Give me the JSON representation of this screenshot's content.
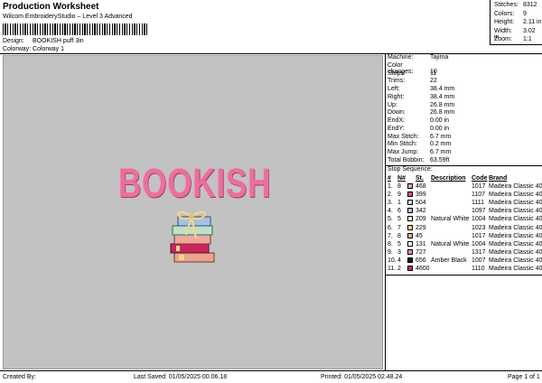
{
  "header": {
    "title": "Production Worksheet",
    "subtitle": "Wilcom EmbroideryStudio – Level 3 Advanced",
    "design_label": "Design:",
    "design_value": "BOOKISH puff 3in",
    "colorway_label": "Colorway:",
    "colorway_value": "Colorway 1"
  },
  "stats": [
    {
      "label": "Stitches:",
      "value": "8312"
    },
    {
      "label": "Colors:",
      "value": "9"
    },
    {
      "label": "Height:",
      "value": "2.11 in"
    },
    {
      "label": "Width:",
      "value": "3.02 in"
    },
    {
      "label": "Zoom:",
      "value": "1:1"
    }
  ],
  "design": {
    "word": "BOOKISH",
    "word_color": "#e8709f"
  },
  "machine_info": [
    {
      "label": "Machine:",
      "value": "Tajima"
    },
    {
      "label": "Color changes:",
      "value": "10"
    },
    {
      "label": "Stops:",
      "value": "11"
    },
    {
      "label": "Trims:",
      "value": "22"
    },
    {
      "label": "Left:",
      "value": "38.4 mm"
    },
    {
      "label": "Right:",
      "value": "38.4 mm"
    },
    {
      "label": "Up:",
      "value": "26.8 mm"
    },
    {
      "label": "Down:",
      "value": "26.8 mm"
    },
    {
      "label": "EndX:",
      "value": "0.00 in"
    },
    {
      "label": "EndY:",
      "value": "0.00 in"
    },
    {
      "label": "Max Stitch:",
      "value": "6.7 mm"
    },
    {
      "label": "Min Stitch:",
      "value": "0.2 mm"
    },
    {
      "label": "Max Jump:",
      "value": "6.7 mm"
    },
    {
      "label": "Total Bobbin:",
      "value": "63.59ft"
    }
  ],
  "stop_sequence": {
    "title": "Stop Sequence:",
    "headers": {
      "num": "#",
      "n": "N#",
      "st": "St.",
      "description": "Description",
      "code": "Code",
      "brand": "Brand"
    },
    "rows": [
      {
        "num": "1.",
        "n": "8",
        "st": "468",
        "color": "#f0a6a0",
        "description": "",
        "code": "1017",
        "brand": "Madeira Classic 40"
      },
      {
        "num": "2.",
        "n": "9",
        "st": "399",
        "color": "#e0506e",
        "description": "",
        "code": "1107",
        "brand": "Madeira Classic 40"
      },
      {
        "num": "3.",
        "n": "1",
        "st": "504",
        "color": "#bfe0c8",
        "description": "",
        "code": "1111",
        "brand": "Madeira Classic 40"
      },
      {
        "num": "4.",
        "n": "6",
        "st": "342",
        "color": "#a9c0e6",
        "description": "",
        "code": "1097",
        "brand": "Madeira Classic 40"
      },
      {
        "num": "5.",
        "n": "5",
        "st": "209",
        "color": "#ffffff",
        "description": "Natural White",
        "code": "1004",
        "brand": "Madeira Classic 40"
      },
      {
        "num": "6.",
        "n": "7",
        "st": "229",
        "color": "#f6d784",
        "description": "",
        "code": "1023",
        "brand": "Madeira Classic 40"
      },
      {
        "num": "7.",
        "n": "8",
        "st": "45",
        "color": "#f0a6a0",
        "description": "",
        "code": "1017",
        "brand": "Madeira Classic 40"
      },
      {
        "num": "8.",
        "n": "5",
        "st": "131",
        "color": "#ffffff",
        "description": "Natural White",
        "code": "1004",
        "brand": "Madeira Classic 40"
      },
      {
        "num": "9.",
        "n": "3",
        "st": "727",
        "color": "#f08a9c",
        "description": "",
        "code": "1317",
        "brand": "Madeira Classic 40"
      },
      {
        "num": "10.",
        "n": "4",
        "st": "656",
        "color": "#1a1a1a",
        "description": "Amber Black",
        "code": "1007",
        "brand": "Madeira Classic 40"
      },
      {
        "num": "11.",
        "n": "2",
        "st": "4600",
        "color": "#c8265e",
        "description": "",
        "code": "1110",
        "brand": "Madeira Classic 40"
      }
    ]
  },
  "footer": {
    "created_by": "Created By:",
    "last_saved": "Last Saved: 01/05/2025 00.06.18",
    "printed": "Printed: 01/05/2025 02.48.24",
    "page": "Page 1 of 1"
  }
}
